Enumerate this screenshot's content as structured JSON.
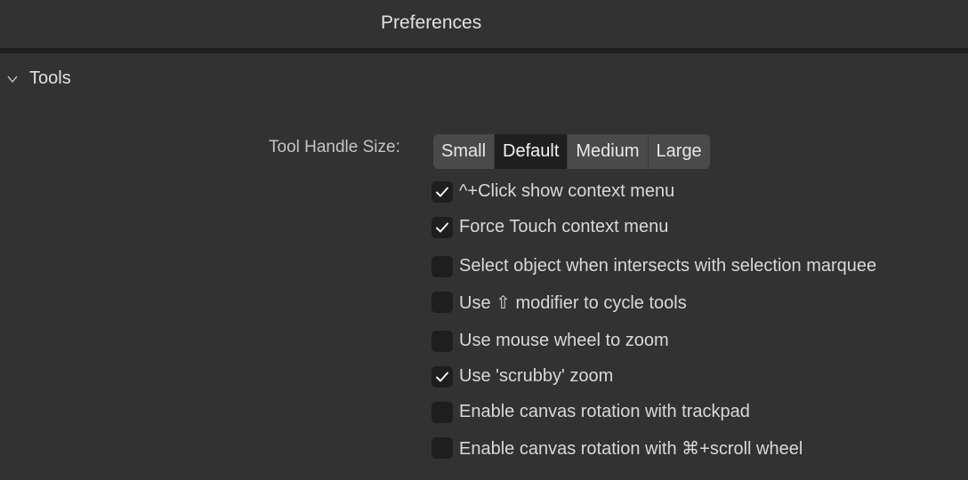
{
  "window": {
    "title": "Preferences"
  },
  "section": {
    "label": "Tools",
    "expanded": true
  },
  "tool_handle_size": {
    "label": "Tool Handle Size:",
    "options": [
      "Small",
      "Default",
      "Medium",
      "Large"
    ],
    "selected": "Default"
  },
  "options": [
    {
      "label": "^+Click show context menu",
      "checked": true
    },
    {
      "label": "Force Touch context menu",
      "checked": true
    },
    {
      "label": "Select object when intersects with selection marquee",
      "checked": false
    },
    {
      "label": "Use ⇧ modifier to cycle tools",
      "checked": false
    },
    {
      "label": "Use mouse wheel to zoom",
      "checked": false
    },
    {
      "label": "Use 'scrubby' zoom",
      "checked": true
    },
    {
      "label": "Enable canvas rotation with trackpad",
      "checked": false
    },
    {
      "label": "Enable canvas rotation with ⌘+scroll wheel",
      "checked": false
    }
  ],
  "colors": {
    "background": "#323232",
    "checkbox": "#1e1e1e",
    "segment": "#4a4a4a",
    "segment_active": "#1f1f1f"
  }
}
